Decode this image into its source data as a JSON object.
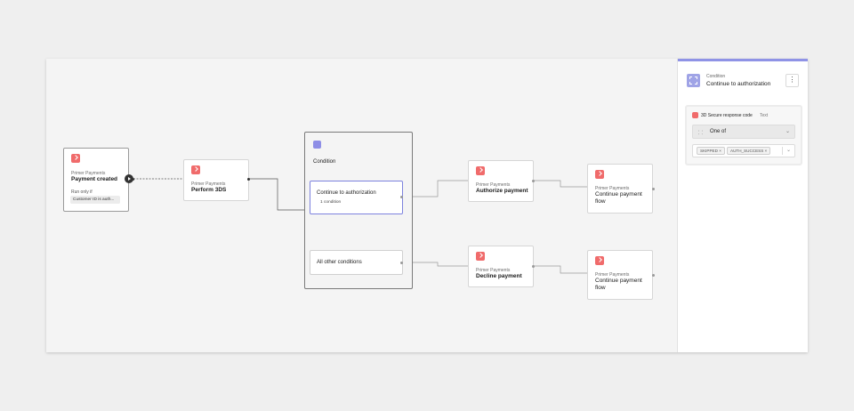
{
  "nodes": {
    "trigger": {
      "provider": "Primer Payments",
      "title": "Payment created",
      "run_label": "Run only if",
      "run_value": "Customer ID is auth..."
    },
    "perform3ds": {
      "provider": "Primer Payments",
      "title": "Perform 3DS"
    },
    "authorize": {
      "provider": "Primer Payments",
      "title": "Authorize payment"
    },
    "continue_top": {
      "provider": "Primer Payments",
      "title_line1": "Continue payment",
      "title_line2": "flow"
    },
    "decline": {
      "provider": "Primer Payments",
      "title": "Decline payment"
    },
    "continue_bottom": {
      "provider": "Primer Payments",
      "title_line1": "Continue payment",
      "title_line2": "flow"
    }
  },
  "condition_group": {
    "label": "Condition",
    "branches": [
      {
        "title": "Continue to authorization",
        "subtitle": "1 condition"
      },
      {
        "title": "All other conditions"
      }
    ]
  },
  "panel": {
    "subtitle": "Condition",
    "title": "Continue to authorization",
    "menu_label": "⋮",
    "rule": {
      "attribute": "3D Secure response code",
      "attribute_type": "Text",
      "operator_icon": "⸬",
      "operator": "One of",
      "operator_chevron": "⌄",
      "values": [
        "SKIPPED ×",
        "AUTH_SUCCESS ×"
      ],
      "values_chevron": "⌄"
    }
  },
  "colors": {
    "accent": "#8f93e6",
    "brand": "#f06b6b",
    "canvas": "#f4f4f4"
  }
}
